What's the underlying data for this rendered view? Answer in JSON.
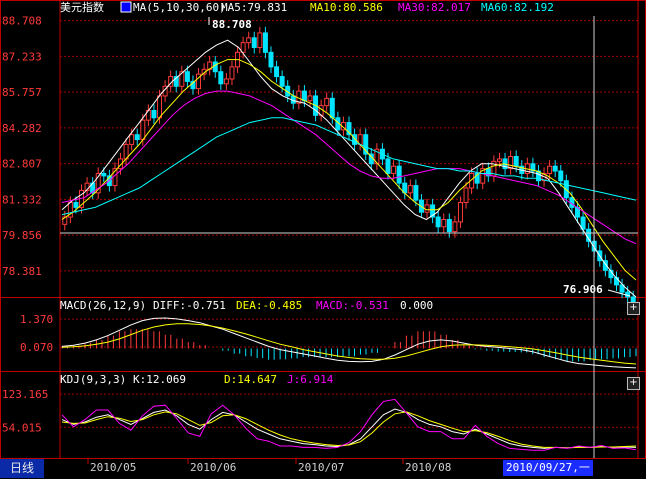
{
  "title": "美元指数",
  "main": {
    "legend": {
      "ma_params": "MA(5,10,30,60)",
      "ma5": "MA5:79.831",
      "ma10": "MA10:80.586",
      "ma30": "MA30:82.017",
      "ma60": "MA60:82.192"
    },
    "ticks": [
      "88.708",
      "87.233",
      "85.757",
      "84.282",
      "82.807",
      "81.332",
      "79.856",
      "78.381"
    ],
    "high_label": "88.708",
    "low_label": "76.906"
  },
  "macd": {
    "legend": {
      "params": "MACD(26,12,9)",
      "diff": "DIFF:-0.751",
      "dea": "DEA:-0.485",
      "macd": "MACD:-0.531",
      "extra": "0.000"
    },
    "ticks": [
      "1.370",
      "0.070"
    ]
  },
  "kdj": {
    "legend": {
      "params": "KDJ(9,3,3)",
      "k": "K:12.069",
      "d": "D:14.647",
      "j": "J:6.914"
    },
    "ticks": [
      "123.165",
      "54.015"
    ]
  },
  "xaxis": {
    "period": "日线",
    "dates": [
      "2010/05",
      "2010/06",
      "2010/07",
      "2010/08"
    ],
    "cursor_date": "2010/09/27,一"
  },
  "colors": {
    "up": "#ff3b3b",
    "down": "#00e5ff",
    "ma5": "#ffffff",
    "ma10": "#ffff00",
    "ma30": "#ff00ff",
    "ma60": "#00ffff",
    "grid": "#a00000"
  },
  "chart_data": [
    {
      "type": "candlestick",
      "title": "美元指数",
      "y_ticks": [
        88.708,
        87.233,
        85.757,
        84.282,
        82.807,
        81.332,
        79.856,
        78.381
      ],
      "ylim": [
        77.3,
        88.9
      ],
      "x_labels": [
        "2010/05",
        "2010/06",
        "2010/07",
        "2010/08"
      ],
      "high": 88.708,
      "low": 76.906,
      "close_series": [
        80.6,
        81.2,
        81.0,
        81.7,
        82.0,
        81.6,
        82.4,
        82.3,
        81.9,
        82.6,
        83.0,
        83.6,
        84.0,
        83.8,
        84.6,
        85.0,
        84.7,
        85.6,
        86.0,
        86.4,
        86.0,
        86.6,
        86.2,
        85.9,
        86.5,
        86.7,
        87.0,
        86.6,
        86.1,
        86.3,
        86.8,
        87.4,
        87.8,
        88.0,
        87.6,
        88.2,
        87.4,
        86.8,
        86.4,
        86.0,
        85.6,
        85.3,
        85.8,
        85.4,
        85.6,
        84.8,
        85.2,
        85.5,
        84.7,
        84.2,
        84.5,
        84.0,
        83.6,
        84.0,
        83.2,
        82.8,
        83.4,
        83.0,
        82.4,
        82.7,
        82.0,
        81.6,
        81.9,
        81.3,
        80.8,
        81.1,
        80.6,
        80.2,
        80.5,
        80.0,
        80.4,
        81.2,
        81.8,
        82.4,
        82.0,
        82.6,
        82.3,
        82.9,
        83.0,
        82.6,
        83.1,
        82.7,
        82.4,
        82.8,
        82.5,
        82.1,
        82.4,
        82.7,
        82.5,
        82.1,
        81.4,
        81.0,
        80.6,
        80.1,
        79.6,
        79.2,
        78.8,
        78.4,
        78.1,
        77.8,
        77.5,
        77.3,
        77.1
      ],
      "series": [
        {
          "name": "MA5",
          "values": [
            80.9,
            81.3,
            81.6,
            82.1,
            82.7,
            83.3,
            83.9,
            84.5,
            85.1,
            85.7,
            86.2,
            86.6,
            87.0,
            87.4,
            87.7,
            87.9,
            87.6,
            87.0,
            86.4,
            85.9,
            85.6,
            85.4,
            85.3,
            85.0,
            84.6,
            84.1,
            83.6,
            83.1,
            82.6,
            82.1,
            81.6,
            81.1,
            80.7,
            80.5,
            80.8,
            81.4,
            82.0,
            82.5,
            82.8,
            82.8,
            82.7,
            82.6,
            82.5,
            82.4,
            82.2,
            81.6,
            80.9,
            80.2,
            79.5,
            78.8,
            78.2,
            77.7,
            77.3
          ]
        },
        {
          "name": "MA10",
          "values": [
            80.5,
            80.8,
            81.2,
            81.6,
            82.1,
            82.6,
            83.1,
            83.6,
            84.2,
            84.8,
            85.3,
            85.8,
            86.2,
            86.6,
            86.9,
            87.1,
            87.1,
            86.9,
            86.6,
            86.2,
            85.9,
            85.6,
            85.4,
            85.2,
            84.9,
            84.5,
            84.1,
            83.6,
            83.1,
            82.6,
            82.1,
            81.6,
            81.2,
            80.9,
            80.9,
            81.2,
            81.7,
            82.1,
            82.5,
            82.7,
            82.8,
            82.7,
            82.6,
            82.5,
            82.3,
            82.0,
            81.6,
            81.0,
            80.3,
            79.6,
            79.0,
            78.4,
            78.0
          ]
        },
        {
          "name": "MA30",
          "values": [
            81.2,
            81.3,
            81.4,
            81.7,
            82.0,
            82.4,
            82.8,
            83.3,
            83.8,
            84.3,
            84.8,
            85.2,
            85.5,
            85.7,
            85.8,
            85.8,
            85.7,
            85.6,
            85.4,
            85.2,
            84.9,
            84.6,
            84.3,
            84.0,
            83.6,
            83.2,
            82.8,
            82.5,
            82.3,
            82.2,
            82.2,
            82.3,
            82.4,
            82.5,
            82.6,
            82.6,
            82.6,
            82.5,
            82.4,
            82.3,
            82.2,
            82.1,
            82.0,
            81.9,
            81.7,
            81.5,
            81.2,
            80.9,
            80.6,
            80.3,
            80.0,
            79.7,
            79.5
          ]
        },
        {
          "name": "MA60",
          "values": [
            80.7,
            80.8,
            80.9,
            81.0,
            81.2,
            81.4,
            81.6,
            81.8,
            82.1,
            82.4,
            82.7,
            83.0,
            83.3,
            83.6,
            83.9,
            84.1,
            84.3,
            84.5,
            84.6,
            84.7,
            84.7,
            84.6,
            84.5,
            84.4,
            84.2,
            84.0,
            83.8,
            83.6,
            83.4,
            83.2,
            83.0,
            82.9,
            82.8,
            82.7,
            82.6,
            82.6,
            82.5,
            82.5,
            82.4,
            82.4,
            82.3,
            82.3,
            82.2,
            82.2,
            82.1,
            82.0,
            81.9,
            81.8,
            81.7,
            81.6,
            81.5,
            81.4,
            81.3
          ]
        }
      ]
    },
    {
      "type": "bar",
      "title": "MACD(26,12,9)",
      "y_ticks": [
        1.37,
        0.07
      ],
      "ylim": [
        -1.0,
        1.7
      ],
      "series": [
        {
          "name": "DIFF",
          "values": [
            0.1,
            0.15,
            0.25,
            0.4,
            0.6,
            0.85,
            1.1,
            1.3,
            1.4,
            1.42,
            1.38,
            1.3,
            1.2,
            1.05,
            0.9,
            0.7,
            0.5,
            0.3,
            0.1,
            -0.05,
            -0.15,
            -0.25,
            -0.35,
            -0.45,
            -0.55,
            -0.6,
            -0.62,
            -0.6,
            -0.5,
            -0.3,
            -0.05,
            0.2,
            0.35,
            0.4,
            0.35,
            0.25,
            0.15,
            0.1,
            0.05,
            0.0,
            -0.05,
            -0.15,
            -0.3,
            -0.45,
            -0.6,
            -0.7,
            -0.75,
            -0.8,
            -0.85,
            -0.88,
            -0.9
          ]
        },
        {
          "name": "DEA",
          "values": [
            0.05,
            0.08,
            0.12,
            0.2,
            0.3,
            0.45,
            0.65,
            0.85,
            1.0,
            1.1,
            1.15,
            1.15,
            1.12,
            1.05,
            0.95,
            0.82,
            0.68,
            0.52,
            0.36,
            0.2,
            0.08,
            -0.05,
            -0.15,
            -0.25,
            -0.35,
            -0.42,
            -0.48,
            -0.5,
            -0.5,
            -0.45,
            -0.35,
            -0.2,
            -0.05,
            0.08,
            0.15,
            0.18,
            0.17,
            0.15,
            0.12,
            0.08,
            0.04,
            -0.02,
            -0.1,
            -0.2,
            -0.3,
            -0.4,
            -0.48,
            -0.55,
            -0.62,
            -0.68,
            -0.72
          ]
        }
      ]
    },
    {
      "type": "line",
      "title": "KDJ(9,3,3)",
      "y_ticks": [
        123.165,
        54.015
      ],
      "ylim": [
        -10,
        140
      ],
      "series": [
        {
          "name": "K",
          "values": [
            70,
            60,
            65,
            75,
            80,
            70,
            60,
            72,
            85,
            90,
            78,
            60,
            50,
            70,
            85,
            80,
            65,
            50,
            40,
            30,
            25,
            20,
            18,
            15,
            14,
            18,
            30,
            55,
            80,
            92,
            85,
            70,
            60,
            55,
            45,
            40,
            50,
            40,
            30,
            20,
            15,
            12,
            10,
            12,
            11,
            13,
            12,
            14,
            12,
            13,
            12
          ]
        },
        {
          "name": "D",
          "values": [
            65,
            62,
            63,
            70,
            76,
            73,
            66,
            70,
            80,
            86,
            82,
            70,
            58,
            64,
            78,
            80,
            72,
            60,
            48,
            38,
            30,
            25,
            21,
            18,
            16,
            17,
            24,
            42,
            65,
            82,
            86,
            78,
            68,
            60,
            52,
            45,
            47,
            43,
            35,
            26,
            19,
            15,
            12,
            12,
            11,
            12,
            12,
            13,
            13,
            14,
            15
          ]
        },
        {
          "name": "J",
          "values": [
            80,
            55,
            70,
            90,
            90,
            62,
            48,
            78,
            98,
            100,
            72,
            42,
            35,
            82,
            100,
            80,
            52,
            30,
            25,
            15,
            15,
            12,
            12,
            10,
            12,
            22,
            45,
            80,
            108,
            112,
            84,
            55,
            45,
            45,
            30,
            30,
            58,
            35,
            20,
            10,
            8,
            6,
            6,
            12,
            10,
            15,
            12,
            16,
            10,
            11,
            7
          ]
        }
      ]
    }
  ]
}
